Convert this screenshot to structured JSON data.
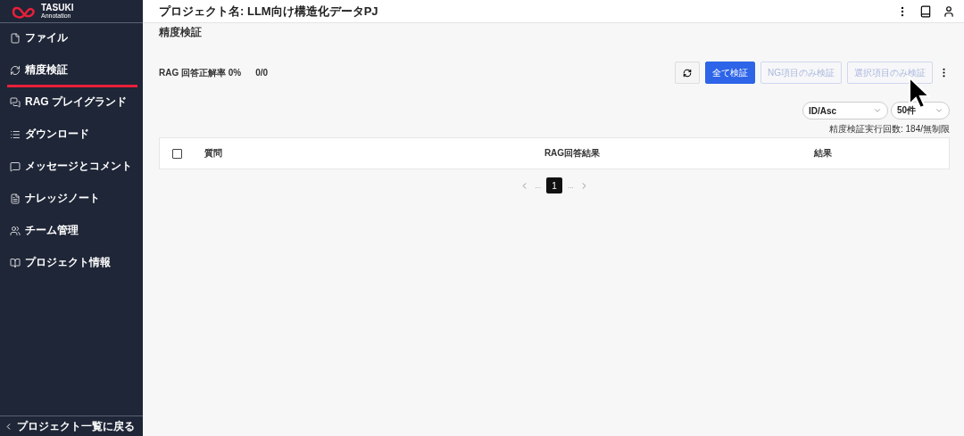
{
  "logo": {
    "name": "TASUKI",
    "sub": "Annotation"
  },
  "sidebar": {
    "items": [
      {
        "label": "ファイル",
        "selected": false
      },
      {
        "label": "精度検証",
        "selected": true
      },
      {
        "label": "RAG プレイグランド",
        "selected": false
      },
      {
        "label": "ダウンロード",
        "selected": false
      },
      {
        "label": "メッセージとコメント",
        "selected": false
      },
      {
        "label": "ナレッジノート",
        "selected": false
      },
      {
        "label": "チーム管理",
        "selected": false
      },
      {
        "label": "プロジェクト情報",
        "selected": false
      }
    ],
    "back": "プロジェクト一覧に戻る"
  },
  "header": {
    "title": "プロジェクト名: LLM向け構造化データPJ"
  },
  "page": {
    "title": "精度検証",
    "summary": "RAG 回答正解率 0%",
    "count": "0/0",
    "buttons": [
      {
        "label": "全て検証",
        "disabled": false,
        "primary": true
      },
      {
        "label": "NG項目のみ検証",
        "disabled": true,
        "primary": false
      },
      {
        "label": "選択項目のみ検証",
        "disabled": true,
        "primary": false
      }
    ],
    "sort": "ID/Asc",
    "per_page": "50件",
    "usage": "精度検証実行回数: 184/無制限"
  },
  "table": {
    "columns": [
      "質問",
      "RAG回答結果",
      "結果"
    ],
    "select_all": false
  },
  "pagination": {
    "pages": [
      {
        "label": "1",
        "selected": true
      }
    ],
    "ellipsis": "..."
  }
}
